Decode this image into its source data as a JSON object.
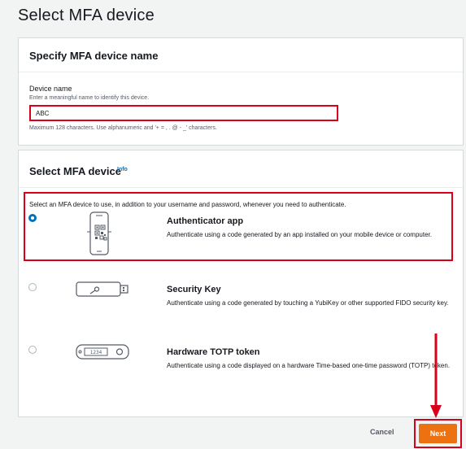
{
  "page": {
    "title": "Select MFA device"
  },
  "name_section": {
    "title": "Specify MFA device name",
    "label": "Device name",
    "description": "Enter a meaningful name to identify this device.",
    "value": "ABC",
    "hint": "Maximum 128 characters. Use alphanumeric and '+ = , . @ - _' characters."
  },
  "device_section": {
    "title": "Select MFA device",
    "info_label": "Info",
    "instruction": "Select an MFA device to use, in addition to your username and password, whenever you need to authenticate.",
    "options": [
      {
        "title": "Authenticator app",
        "description": "Authenticate using a code generated by an app installed on your mobile device or computer.",
        "selected": true,
        "icon": "phone-qr-icon"
      },
      {
        "title": "Security Key",
        "description": "Authenticate using a code generated by touching a YubiKey or other supported FIDO security key.",
        "selected": false,
        "icon": "usb-key-icon"
      },
      {
        "title": "Hardware TOTP token",
        "description": "Authenticate using a code displayed on a hardware Time-based one-time password (TOTP) token.",
        "selected": false,
        "icon": "totp-token-icon"
      }
    ]
  },
  "footer": {
    "cancel_label": "Cancel",
    "next_label": "Next"
  },
  "colors": {
    "accent": "#0073bb",
    "primary_button": "#ec7211",
    "annotation": "#d9001b",
    "background": "#f2f3f3"
  }
}
